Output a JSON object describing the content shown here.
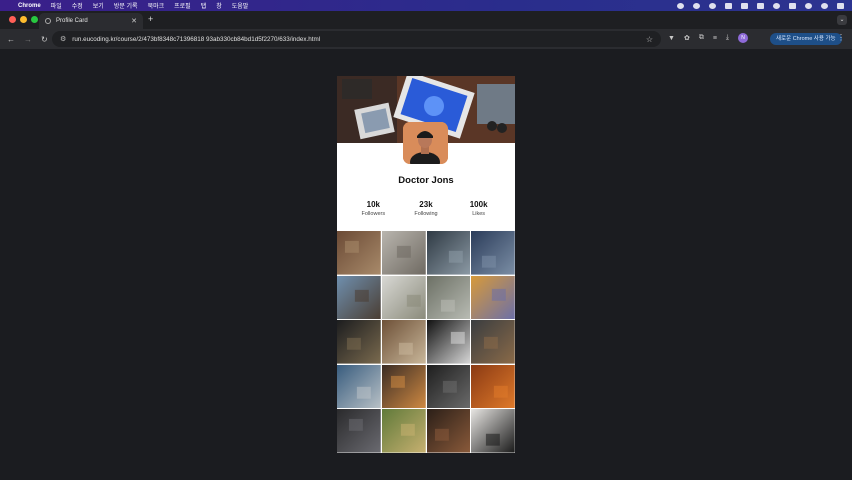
{
  "menubar": {
    "app": "Chrome",
    "items": [
      "파일",
      "수정",
      "보기",
      "방문 기록",
      "북마크",
      "프로필",
      "탭",
      "창",
      "도움말"
    ]
  },
  "tab": {
    "title": "Profile Card"
  },
  "toolbar": {
    "url": "run.eucoding.kr/course/2/473bf8348c71396818 93ab330cb84bd1d5f2270/633/index.html",
    "new_chrome": "새로운 Chrome 사용 가능",
    "profile_initial": "N"
  },
  "profile": {
    "name": "Doctor Jons",
    "stats": [
      {
        "value": "10k",
        "label": "Followers"
      },
      {
        "value": "23k",
        "label": "Following"
      },
      {
        "value": "100k",
        "label": "Likes"
      }
    ]
  },
  "gallery": {
    "tiles": [
      [
        "#6b4a35",
        "#a88a6a"
      ],
      [
        "#b9b5ae",
        "#6f6a62"
      ],
      [
        "#2f3a44",
        "#8c9aa5"
      ],
      [
        "#2b3c5a",
        "#7b8ea5"
      ],
      [
        "#6f8fae",
        "#4a3d32"
      ],
      [
        "#d8d8d4",
        "#8a8a7a"
      ],
      [
        "#6c7065",
        "#b9bcb4"
      ],
      [
        "#d79a3a",
        "#6b6fa8"
      ],
      [
        "#1c1d1f",
        "#7a6a4e"
      ],
      [
        "#6e5138",
        "#c9b79a"
      ],
      [
        "#111111",
        "#d8d8d8"
      ],
      [
        "#3a3d40",
        "#8a6a48"
      ],
      [
        "#385c7e",
        "#b9c1c6"
      ],
      [
        "#3a2c25",
        "#d08a42"
      ],
      [
        "#1e1e1e",
        "#6b6b6b"
      ],
      [
        "#8a3a14",
        "#e07a2a"
      ],
      [
        "#2a2a2c",
        "#6a6a70"
      ],
      [
        "#607a3a",
        "#c7b070"
      ],
      [
        "#2b1f18",
        "#8a5a3a"
      ],
      [
        "#e8e6e3",
        "#1a1a1a"
      ]
    ]
  }
}
